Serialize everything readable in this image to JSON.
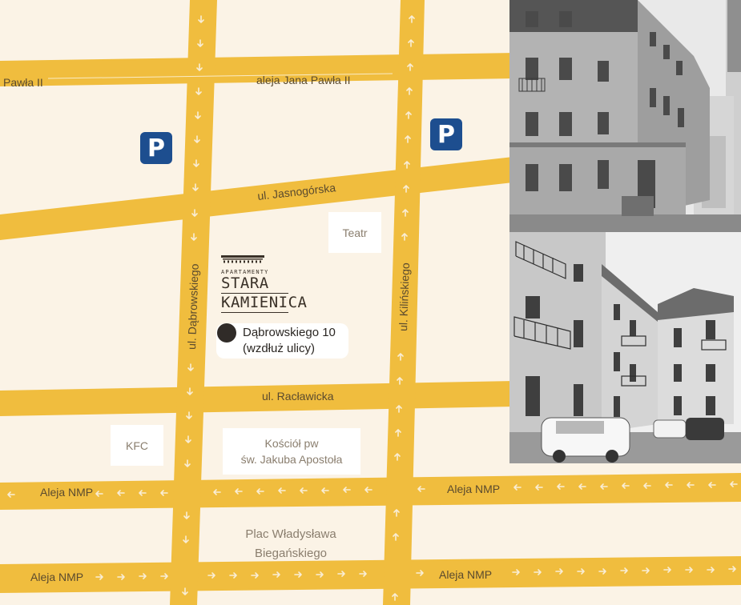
{
  "streets": {
    "jana_pawla_left": "Pawła II",
    "jana_pawla_main": "aleja Jana Pawła II",
    "jasnogorska": "ul. Jasnogórska",
    "dabrowskiego": "ul. Dąbrowskiego",
    "kilinskiego": "ul. Kilińskiego",
    "raclawicka": "ul. Racławicka",
    "nmp_upper_left": "Aleja NMP",
    "nmp_upper_right": "Aleja NMP",
    "nmp_lower_left": "Aleja NMP",
    "nmp_lower_right": "Aleja NMP"
  },
  "parking_symbol": "P",
  "places": {
    "teatr": "Teatr",
    "kfc": "KFC",
    "church_line1": "Kościół pw",
    "church_line2": "św. Jakuba Apostoła",
    "square_line1": "Plac Władysława",
    "square_line2": "Biegańskiego"
  },
  "logo": {
    "small": "APARTAMENTY",
    "line1": "STARA",
    "line2": "KAMIENICA"
  },
  "address": {
    "line1": "Dąbrowskiego 10",
    "line2": "(wzdłuż ulicy)"
  },
  "colors": {
    "background": "#fbf3e6",
    "road": "#f0bd3e",
    "parking": "#1d4e8f",
    "marker": "#302b28"
  }
}
